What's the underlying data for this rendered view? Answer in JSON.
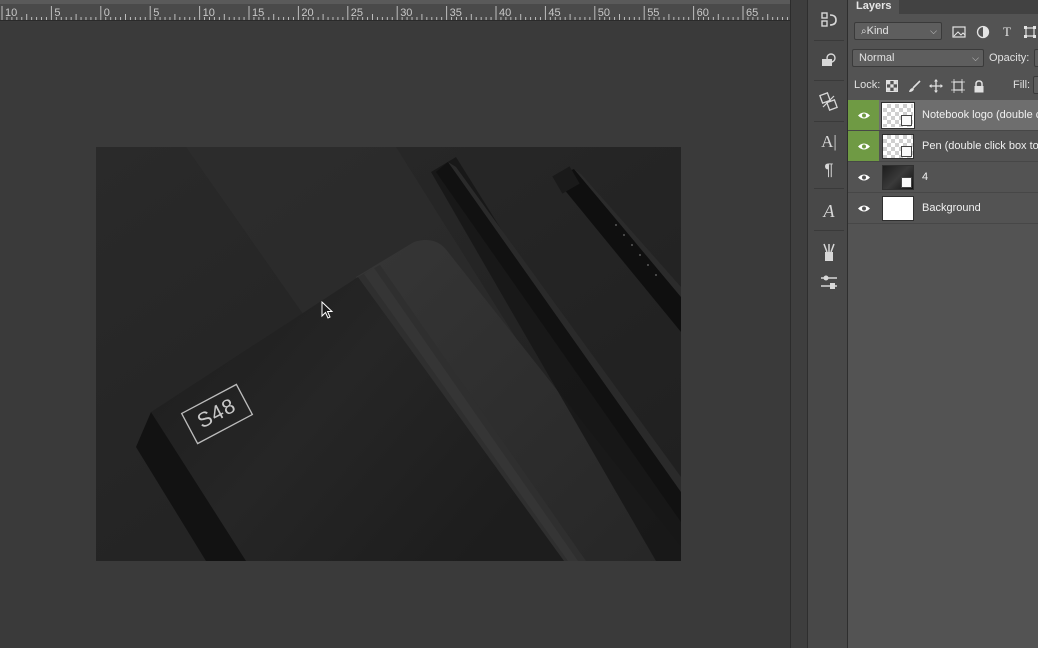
{
  "ruler": {
    "labels": [
      "10",
      "5",
      "0",
      "5",
      "10",
      "15",
      "20",
      "25",
      "30",
      "35",
      "40",
      "45",
      "50",
      "55",
      "60",
      "65"
    ]
  },
  "document": {
    "logo_text": "S48"
  },
  "toolstrip": {
    "icons": [
      "history-icon",
      "3d-material-icon",
      "swatch-rotate-icon",
      "character-icon",
      "paragraph-icon",
      "glyphs-icon",
      "brush-settings-icon",
      "adjustments-icon"
    ]
  },
  "layers_panel": {
    "tab_label": "Layers",
    "filter": {
      "kind_label": "Kind",
      "icons": [
        "image-filter-icon",
        "adjustment-filter-icon",
        "type-filter-icon",
        "shape-filter-icon"
      ]
    },
    "blend": {
      "mode": "Normal",
      "opacity_label": "Opacity:"
    },
    "lock": {
      "label": "Lock:",
      "icons": [
        "lock-transparent-icon",
        "lock-paint-icon",
        "lock-move-icon",
        "lock-artboard-icon",
        "lock-all-icon"
      ],
      "fill_label": "Fill:"
    },
    "layers": [
      {
        "name": "Notebook logo (double c",
        "visible": true,
        "selected": true,
        "eye_highlight": true,
        "thumb": "checker",
        "smart": true
      },
      {
        "name": "Pen (double click box to",
        "visible": true,
        "selected": false,
        "eye_highlight": true,
        "thumb": "checker",
        "smart": true
      },
      {
        "name": "4",
        "visible": true,
        "selected": false,
        "eye_highlight": false,
        "thumb": "photo",
        "smart": true
      },
      {
        "name": "Background",
        "visible": true,
        "selected": false,
        "eye_highlight": false,
        "thumb": "white",
        "smart": false
      }
    ]
  },
  "colors": {
    "visibility_highlight": "#6f9a44",
    "selected_layer": "#6e6e6e",
    "panel_bg": "#535353",
    "canvas_bg": "#3a3a3a"
  }
}
